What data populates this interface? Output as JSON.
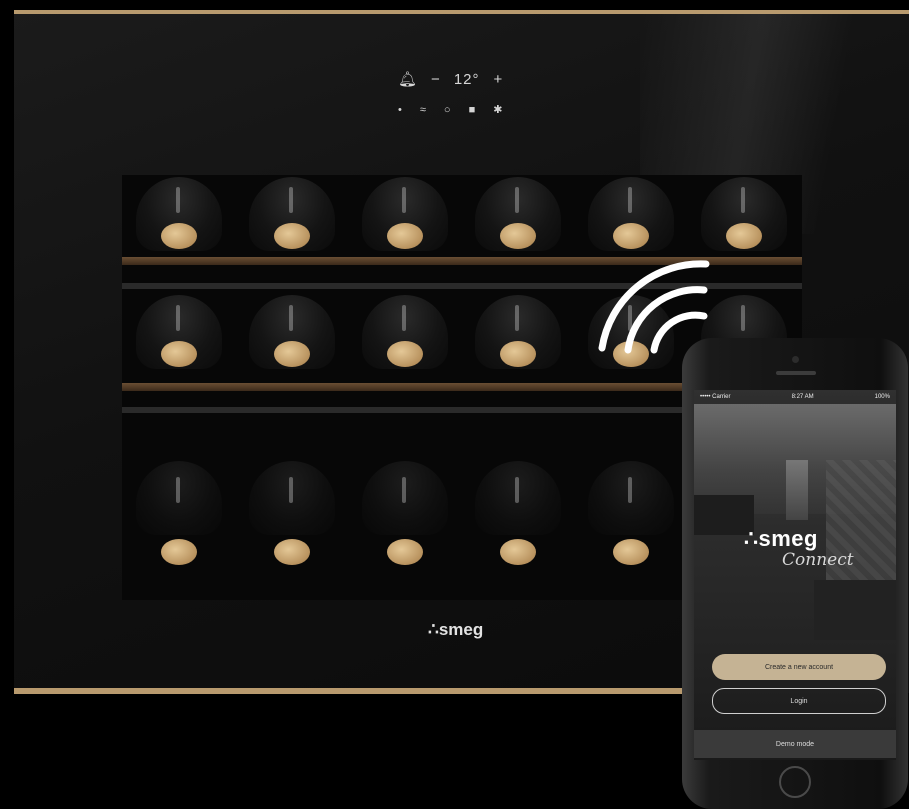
{
  "appliance": {
    "controls_row1": {
      "bell_icon": "bell-icon",
      "minus": "−",
      "temperature": "12°",
      "plus": "+"
    },
    "controls_row2": [
      "light-icon",
      "wifi-icon",
      "power-icon",
      "lock-icon",
      "fan-icon"
    ],
    "brand": "smeg"
  },
  "phone": {
    "status": {
      "left": "••••• Carrier",
      "center": "8:27 AM",
      "right": "100%"
    },
    "app_brand": "smeg",
    "app_sub": "Connect",
    "buttons": {
      "create_account": "Create a new account",
      "login": "Login",
      "demo": "Demo mode"
    }
  },
  "colors": {
    "trim": "#b89a6e",
    "button_accent": "#c5b394",
    "background": "#000000"
  }
}
